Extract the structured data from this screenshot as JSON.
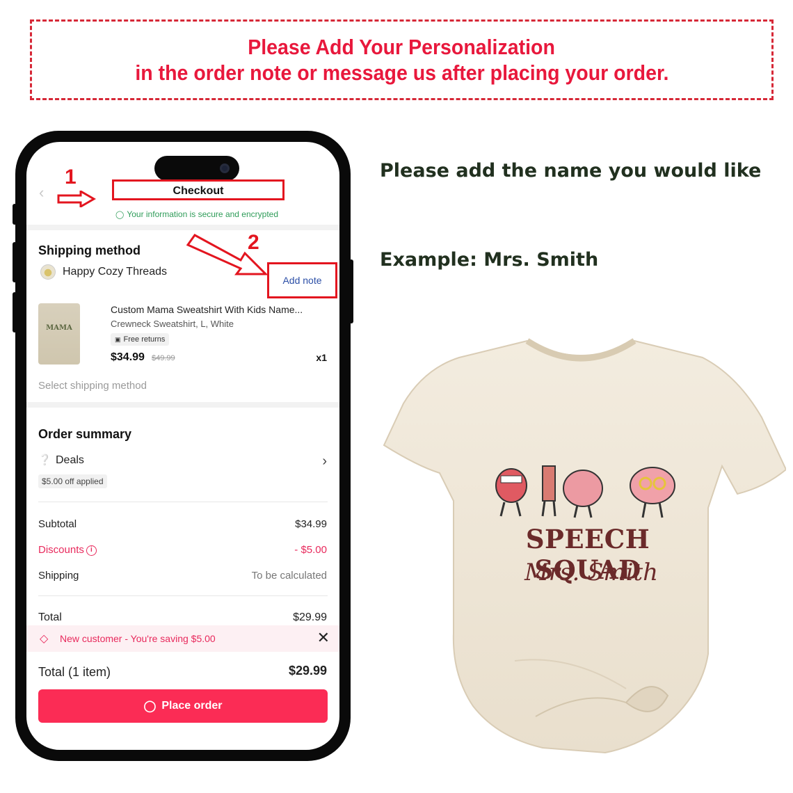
{
  "banner": {
    "line1": "Please Add Your Personalization",
    "line2": "in the order note or message us after placing your order."
  },
  "steps": {
    "one": "1",
    "two": "2"
  },
  "checkout": {
    "title": "Checkout",
    "secure_text": "Your information is secure and encrypted"
  },
  "shipping": {
    "heading": "Shipping method",
    "store_name": "Happy Cozy Threads",
    "add_note": "Add note",
    "product": {
      "image_text": "MAMA",
      "title": "Custom Mama Sweatshirt With Kids Name...",
      "variant": "Crewneck Sweatshirt, L, White",
      "free_returns": "Free returns",
      "price": "$34.99",
      "original_price": "$49.99",
      "quantity": "x1"
    },
    "select_method": "Select shipping method"
  },
  "order_summary": {
    "heading": "Order summary",
    "deals_label": "Deals",
    "deals_badge": "$5.00 off applied",
    "subtotal_label": "Subtotal",
    "subtotal_value": "$34.99",
    "discounts_label": "Discounts",
    "discounts_value": "- $5.00",
    "shipping_label": "Shipping",
    "shipping_value": "To be calculated",
    "total_label": "Total",
    "total_value": "$29.99"
  },
  "toast": {
    "text": "New customer - You're saving $5.00"
  },
  "footer": {
    "total_label": "Total (1 item)",
    "total_value": "$29.99",
    "place_order": "Place order"
  },
  "right": {
    "instruction": "Please add the name you would like",
    "example": "Example: Mrs. Smith"
  },
  "shirt": {
    "title": "SPEECH SQUAD",
    "name": "Mrs. Smith"
  },
  "colors": {
    "banner_red": "#e8183c",
    "annotation_red": "#e3151f",
    "tiktok_pink": "#fb2c55",
    "secure_green": "#2f9c59",
    "link_blue": "#2b4ea6",
    "heading_green": "#21301f",
    "shirt_text": "#6b2a2a"
  }
}
